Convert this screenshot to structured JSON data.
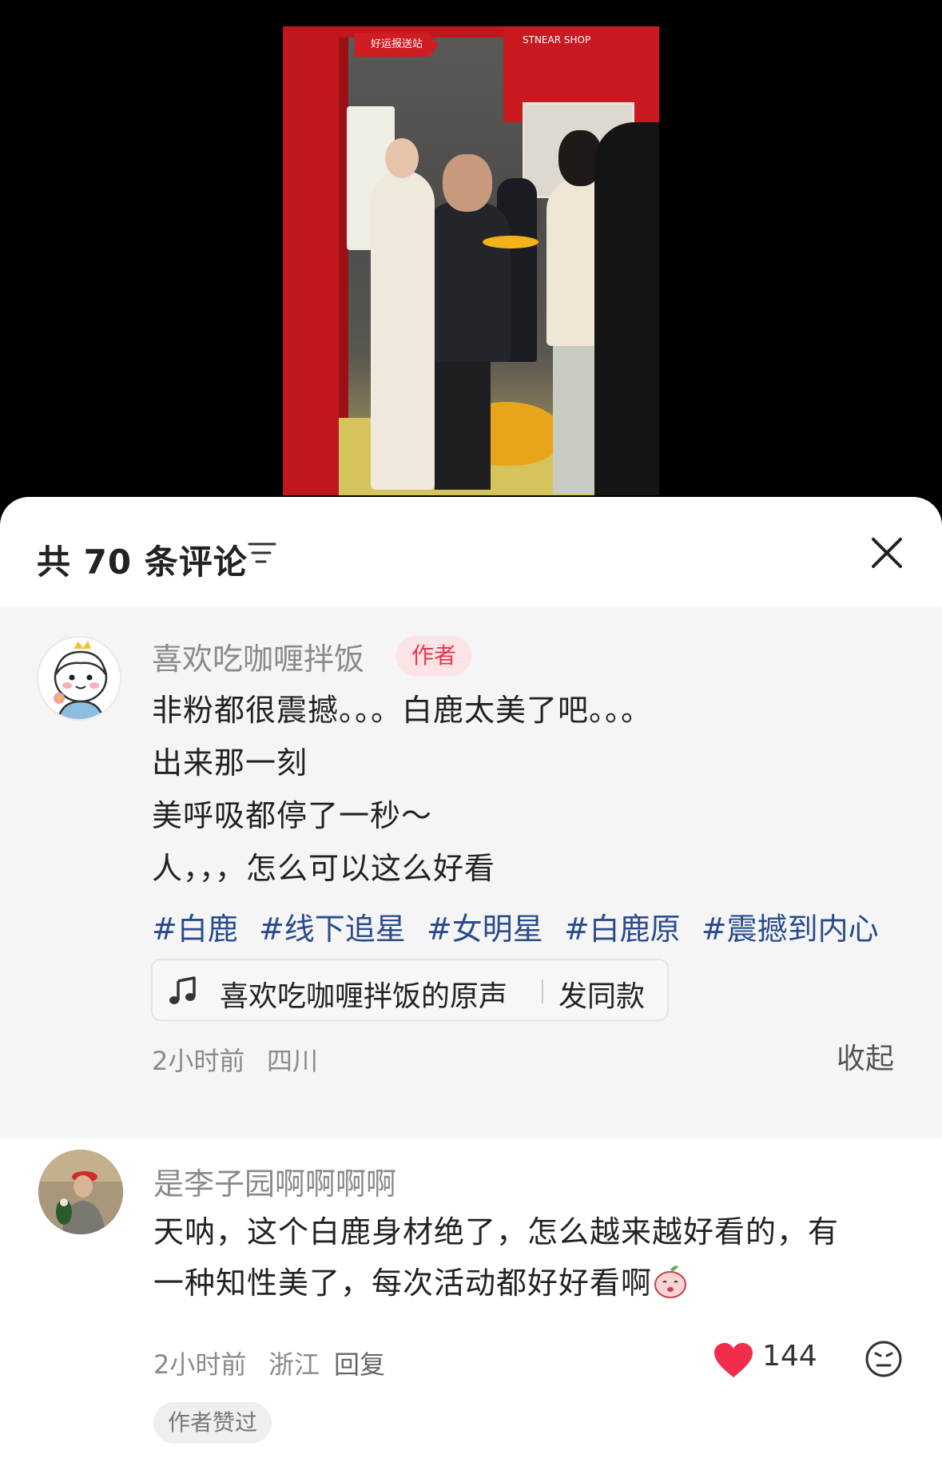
{
  "video": {
    "sign_text": "好运报送站",
    "shop_text": "STNEAR SHOP"
  },
  "comments_panel": {
    "count_prefix": "共",
    "count": "70",
    "count_suffix": "条评论",
    "sort_icon": "sort-lines-icon",
    "close_icon": "close-x-icon"
  },
  "author_comment": {
    "avatar_icon": "cartoon-boy-avatar",
    "username": "喜欢吃咖喱拌饭",
    "tag": "作者",
    "lines": [
      "非粉都很震撼。。。白鹿太美了吧。。。",
      "出来那一刻",
      "美呼吸都停了一秒～",
      "人，，，怎么可以这么好看"
    ],
    "hashtags": [
      "#白鹿",
      "#线下追星",
      "#女明星",
      "#白鹿原",
      "#震撼到内心"
    ],
    "music": {
      "icon": "music-note-icon",
      "name": "喜欢吃咖喱拌饭的原声",
      "action": "发同款"
    },
    "time": "2小时前",
    "location": "四川",
    "collapse": "收起"
  },
  "reply_comment": {
    "username": "是李子园啊啊啊啊",
    "line1": "天呐，这个白鹿身材绝了，怎么越来越好看的，有",
    "line2": "一种知性美了，每次活动都好好看啊",
    "time": "2小时前",
    "location": "浙江",
    "reply": "回复",
    "likes": "144",
    "like_color": "#f02d4b",
    "author_liked": "作者赞过"
  }
}
